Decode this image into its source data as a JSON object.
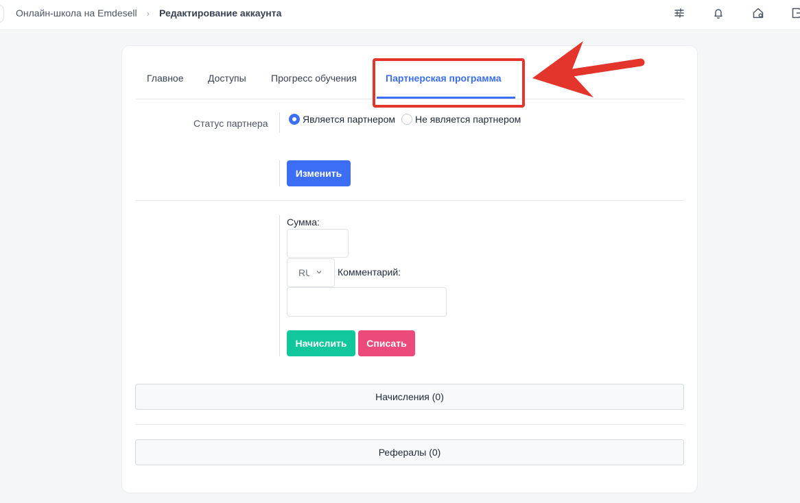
{
  "breadcrumb": {
    "root": "Онлайн-школа на Emdesell",
    "separator": "›",
    "current": "Редактирование аккаунта"
  },
  "topbar_icons": [
    "sliders-icon",
    "bell-icon",
    "home-settings-icon",
    "exit-icon"
  ],
  "tabs": [
    {
      "label": "Главное"
    },
    {
      "label": "Доступы"
    },
    {
      "label": "Прогресс обучения"
    },
    {
      "label": "Партнерская программа",
      "active": true
    }
  ],
  "partner": {
    "status_label": "Статус партнера",
    "options": [
      {
        "label": "Является партнером",
        "checked": true
      },
      {
        "label": "Не является партнером",
        "checked": false
      }
    ],
    "change_button": "Изменить"
  },
  "balance_form": {
    "amount_label": "Сумма:",
    "amount_value": "",
    "currency_value": "RUB",
    "comment_label": "Комментарий:",
    "comment_value": "",
    "credit_button": "Начислить",
    "debit_button": "Списать"
  },
  "panels": {
    "accruals": "Начисления (0)",
    "referrals": "Рефералы (0)"
  },
  "colors": {
    "accent": "#3b6ef5",
    "success": "#12c79b",
    "danger": "#ec4a7a",
    "annotation": "#e3352b"
  }
}
